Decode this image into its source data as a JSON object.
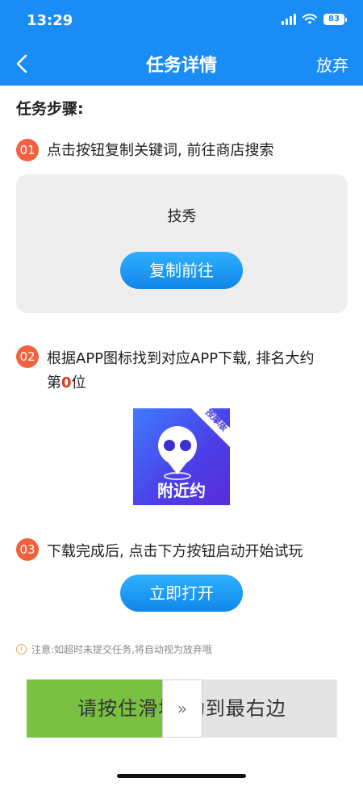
{
  "status_bar": {
    "time": "13:29",
    "battery": "83"
  },
  "nav": {
    "title": "任务详情",
    "action": "放弃",
    "back_icon": "chevron-left-icon"
  },
  "colors": {
    "header_blue": "#1a8cf5",
    "step_badge": "#f2613e",
    "slider_green": "#7ac143",
    "highlight_red": "#e8321e"
  },
  "steps_title": "任务步骤:",
  "step1": {
    "num": "01",
    "text": "点击按钮复制关键词, 前往商店搜索",
    "keyword": "技秀",
    "button": "复制前往"
  },
  "step2": {
    "num": "02",
    "text_line1": "根据APP图标找到对应APP下载, 排名大约",
    "text_prefix": "第",
    "rank": "0",
    "text_suffix": "位",
    "app_icon": {
      "label": "附近约",
      "ribbon": "按摩版"
    }
  },
  "step3": {
    "num": "03",
    "text": "下载完成后, 点击下方按钮启动开始试玩",
    "button": "立即打开"
  },
  "notice": {
    "icon": "info-icon",
    "text": "注意:如超时未提交任务,将自动视为放弃哦"
  },
  "slider": {
    "text": "请按住滑块    动到最右边",
    "handle_glyph": "»"
  }
}
